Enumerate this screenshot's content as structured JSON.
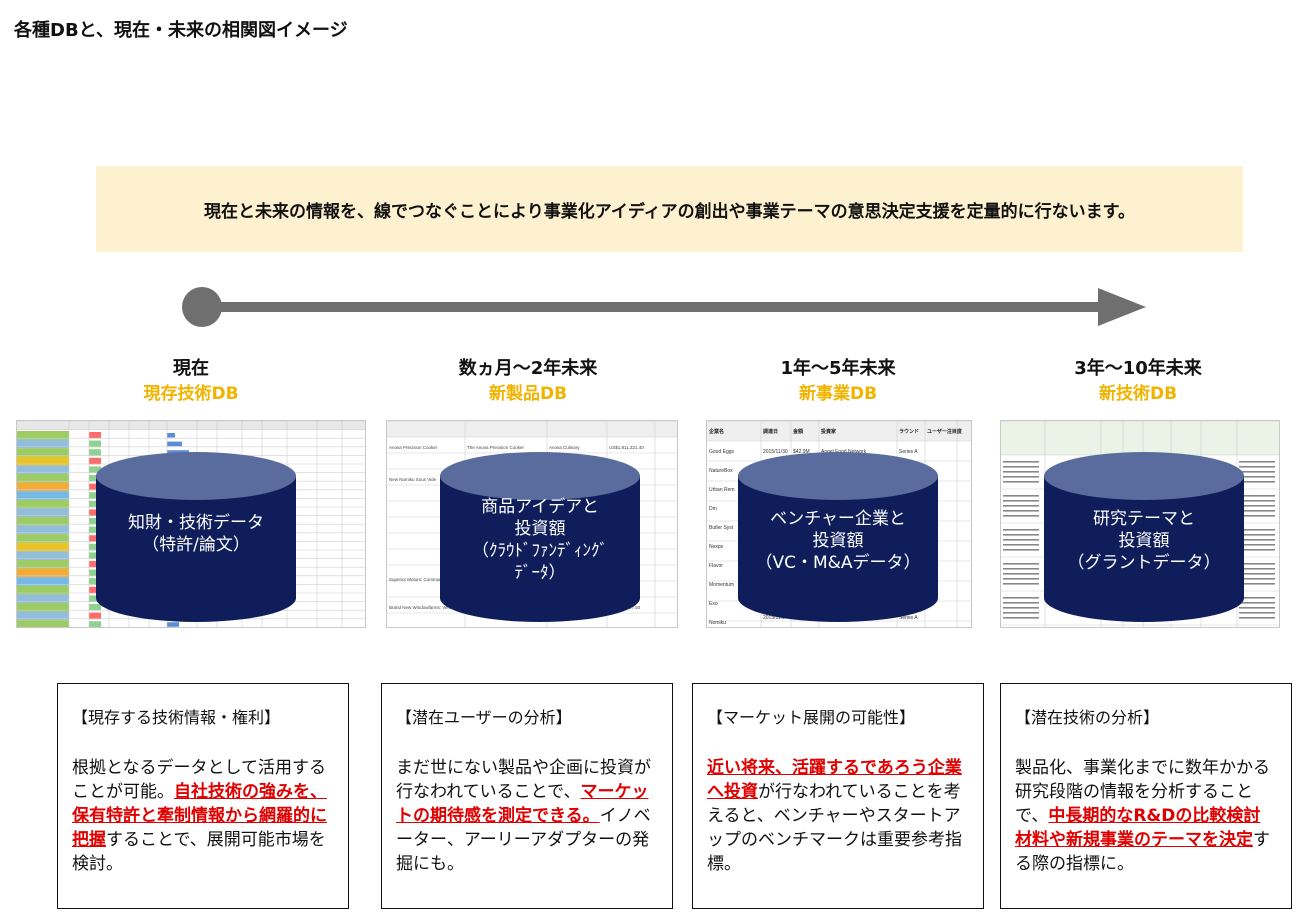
{
  "title": "各種DBと、現在・未来の相関図イメージ",
  "banner": "現在と未来の情報を、線でつなぐことにより事業化アイディアの創出や事業テーマの意思決定支援を定量的に行ないます。",
  "columns": [
    {
      "period": "現在",
      "db": "現存技術DB",
      "cyl_lines": [
        "知財・技術データ",
        "（特許/論文）"
      ],
      "card_heading": "【現存する技術情報・権利】",
      "card_parts": [
        {
          "t": "根拠となるデータとして活用することが可能。",
          "hl": false
        },
        {
          "t": "自社技術の強みを、保有特許と牽制情報から網羅的に把握",
          "hl": true
        },
        {
          "t": "することで、展開可能市場を検討。",
          "hl": false
        }
      ]
    },
    {
      "period": "数ヵ月～2年未来",
      "db": "新製品DB",
      "cyl_lines": [
        "商品アイデアと",
        "投資額",
        "（ｸﾗｳﾄﾞﾌｧﾝﾃﾞｨﾝｸﾞ",
        "ﾃﾞｰﾀ）"
      ],
      "card_heading": "【潜在ユーザーの分析】",
      "card_parts": [
        {
          "t": "まだ世にない製品や企画に投資が行なわれていることで、",
          "hl": false
        },
        {
          "t": "マーケットの期待感を測定できる。",
          "hl": true
        },
        {
          "t": "イノベーター、アーリーアダプターの発掘にも。",
          "hl": false
        }
      ]
    },
    {
      "period": "1年～5年未来",
      "db": "新事業DB",
      "cyl_lines": [
        "ベンチャー企業と",
        "投資額",
        "（VC・M&Aデータ）"
      ],
      "card_heading": "【マーケット展開の可能性】",
      "card_parts": [
        {
          "t": "近い将来、活躍するであろう企業へ投資",
          "hl": true
        },
        {
          "t": "が行なわれていることを考えると、ベンチャーやスタートアップのベンチマークは重要参考指標。",
          "hl": false
        }
      ]
    },
    {
      "period": "3年～10年未来",
      "db": "新技術DB",
      "cyl_lines": [
        "研究テーマと",
        "投資額",
        "（グラントデータ）"
      ],
      "card_heading": "【潜在技術の分析】",
      "card_parts": [
        {
          "t": "製品化、事業化までに数年かかる研究段階の情報を分析することで、",
          "hl": false
        },
        {
          "t": "中長期的なR&Dの比較検討材料や新規事業のテーマを決定",
          "hl": true
        },
        {
          "t": "する際の指標に。",
          "hl": false
        }
      ]
    }
  ],
  "colors": {
    "banner_bg": "#fdf1cf",
    "db_label": "#f0b400",
    "cylinder": "#0f1e5a",
    "cylinder_top": "#5a6b9e",
    "arrow": "#6f6f6f",
    "highlight": "#e00000"
  },
  "thumb_fragments": {
    "t2": [
      "Anova Precision Cooker",
      "The Anova Precision Cooker",
      "Anova Culinary",
      "US$1,811,321.40",
      "New Nomiku Sous Vide",
      "Brand New Windowfarms: Vertical Food Gardens",
      "Superior Motors: Community Restaurant",
      "US$257,307.50"
    ],
    "t3": [
      "企業名",
      "調達日",
      "金額",
      "投資家",
      "ラウンド",
      "ユーザー注目度",
      "Good Eggs",
      "2015/11/30",
      "$42.9M",
      "Angel Food Network",
      "Series A",
      "NatureBox",
      "Urban Rem",
      "Dm",
      "Butler Syst",
      "Nexps",
      "Flavor",
      "Momentum",
      "Exo",
      "Nomiku",
      "2015/11/2",
      "$6.5M",
      "GreenSoil Investments"
    ]
  }
}
